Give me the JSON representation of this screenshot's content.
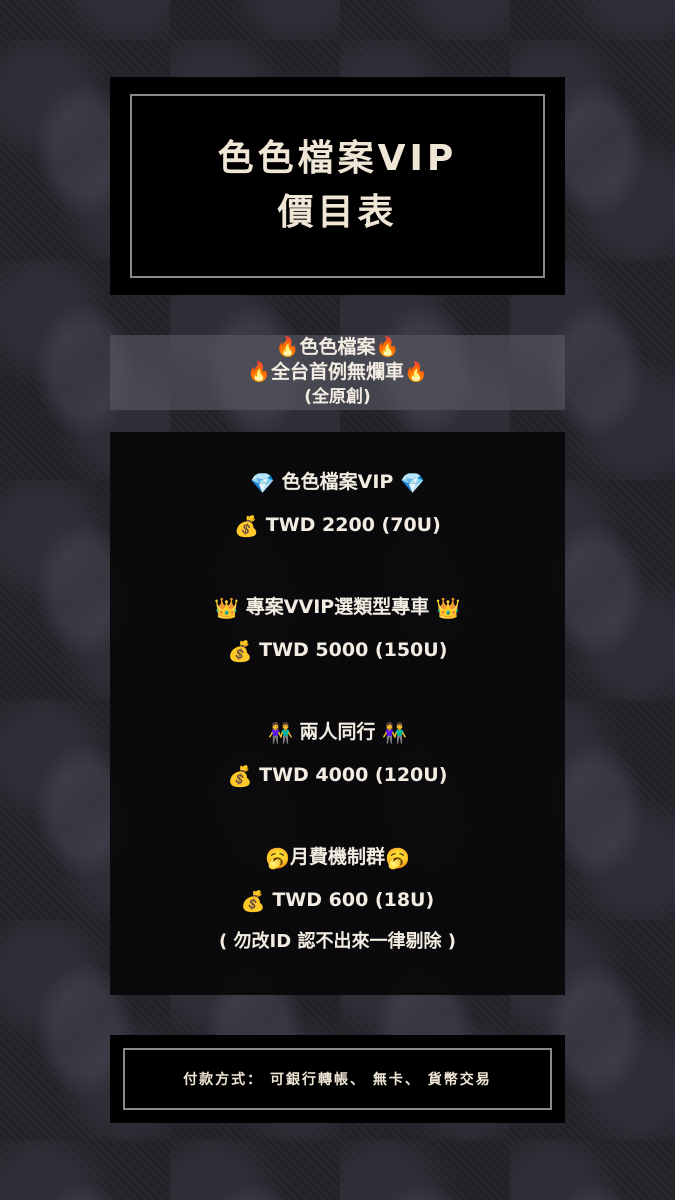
{
  "title": {
    "line1": "色色檔案VIP",
    "line2": "價目表"
  },
  "banner": {
    "line1": "🔥色色檔案🔥",
    "line2": "🔥全台首例無爛車🔥",
    "line3": "(全原創)"
  },
  "items": [
    {
      "icon": "💎",
      "name": "色色檔案VIP",
      "price_icon": "💰",
      "price": "TWD 2200 (70U)"
    },
    {
      "icon": "👑",
      "name": "專案VVIP選類型專車",
      "price_icon": "💰",
      "price": "TWD 5000 (150U)"
    },
    {
      "icon": "👫",
      "name": "兩人同行",
      "price_icon": "💰",
      "price": "TWD 4000 (120U)"
    },
    {
      "icon": "🥱",
      "name": "月費機制群",
      "price_icon": "💰",
      "price": "TWD 600 (18U)",
      "note": "( 勿改ID 認不出來一律剔除 )"
    }
  ],
  "payment": {
    "text": "付款方式： 可銀行轉帳、 無卡、 貨幣交易"
  }
}
